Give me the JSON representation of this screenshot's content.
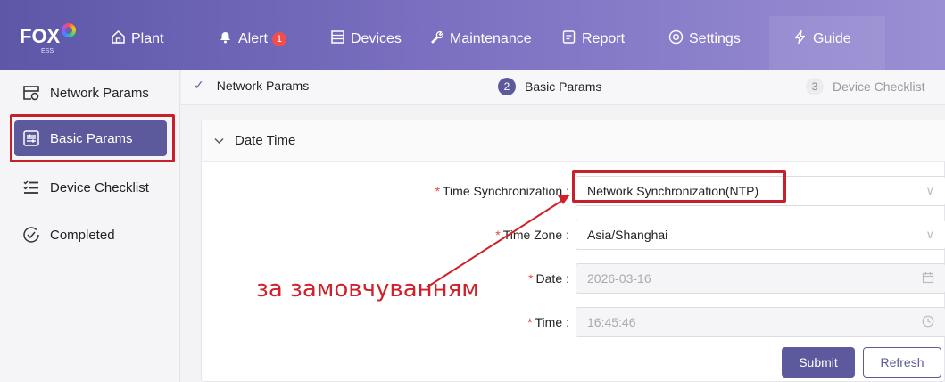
{
  "brand": {
    "logo_text": "FOX",
    "logo_sub": "ESS"
  },
  "nav": {
    "items": [
      {
        "label": "Plant",
        "icon": "home-icon"
      },
      {
        "label": "Alert",
        "icon": "bell-icon",
        "badge": "1"
      },
      {
        "label": "Devices",
        "icon": "devices-icon"
      },
      {
        "label": "Maintenance",
        "icon": "wrench-icon"
      },
      {
        "label": "Report",
        "icon": "report-icon"
      },
      {
        "label": "Settings",
        "icon": "settings-icon"
      },
      {
        "label": "Guide",
        "icon": "lightning-icon"
      }
    ]
  },
  "sidebar": {
    "items": [
      {
        "label": "Network Params",
        "icon": "network-params-icon"
      },
      {
        "label": "Basic Params",
        "icon": "sliders-icon",
        "active": true
      },
      {
        "label": "Device Checklist",
        "icon": "checklist-icon"
      },
      {
        "label": "Completed",
        "icon": "check-circle-icon"
      }
    ]
  },
  "steps": [
    {
      "label": "Network Params",
      "state": "done"
    },
    {
      "num": "2",
      "label": "Basic Params",
      "state": "active"
    },
    {
      "num": "3",
      "label": "Device Checklist",
      "state": "pending"
    }
  ],
  "section": {
    "title": "Date Time"
  },
  "form": {
    "time_sync": {
      "label": "Time Synchronization",
      "value": "Network Synchronization(NTP)"
    },
    "time_zone": {
      "label": "Time Zone",
      "value": "Asia/Shanghai"
    },
    "date": {
      "label": "Date",
      "value": "2026-03-16"
    },
    "time": {
      "label": "Time",
      "value": "16:45:46"
    },
    "colon": ":"
  },
  "buttons": {
    "submit": "Submit",
    "refresh": "Refresh"
  },
  "annotation": {
    "text": "за замовчуванням"
  },
  "colors": {
    "accent": "#5c5a9c",
    "highlight": "#c8202a",
    "required": "#e04a4a"
  }
}
